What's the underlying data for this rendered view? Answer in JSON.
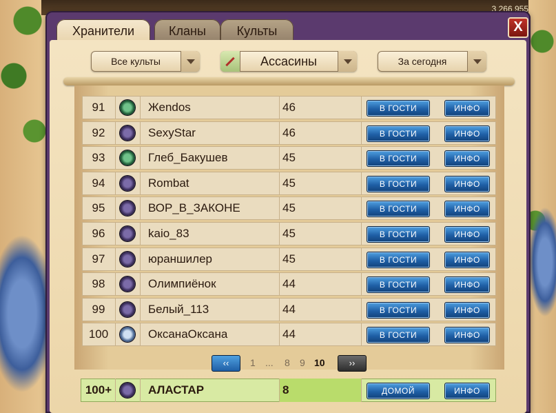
{
  "header": {
    "coins": "3 266 955"
  },
  "tabs": [
    {
      "label": "Хранители",
      "active": true
    },
    {
      "label": "Кланы",
      "active": false
    },
    {
      "label": "Культы",
      "active": false
    }
  ],
  "close_label": "X",
  "filters": {
    "cult": "Все культы",
    "class": "Ассасины",
    "period": "За сегодня"
  },
  "table": {
    "rows": [
      {
        "rank": "91",
        "name": "Жеndos",
        "score": "46",
        "emblem": "green",
        "visit": "В ГОСТИ",
        "info": "ИНФО"
      },
      {
        "rank": "92",
        "name": "SexyStar",
        "score": "46",
        "emblem": "purple",
        "visit": "В ГОСТИ",
        "info": "ИНФО"
      },
      {
        "rank": "93",
        "name": "Глеб_Бакушев",
        "score": "45",
        "emblem": "green",
        "visit": "В ГОСТИ",
        "info": "ИНФО"
      },
      {
        "rank": "94",
        "name": "Rombat",
        "score": "45",
        "emblem": "purple",
        "visit": "В ГОСТИ",
        "info": "ИНФО"
      },
      {
        "rank": "95",
        "name": "ВОР_В_ЗАКОНЕ",
        "score": "45",
        "emblem": "purple",
        "visit": "В ГОСТИ",
        "info": "ИНФО"
      },
      {
        "rank": "96",
        "name": "kaio_83",
        "score": "45",
        "emblem": "purple",
        "visit": "В ГОСТИ",
        "info": "ИНФО"
      },
      {
        "rank": "97",
        "name": "юраншилер",
        "score": "45",
        "emblem": "purple",
        "visit": "В ГОСТИ",
        "info": "ИНФО"
      },
      {
        "rank": "98",
        "name": "Олимпиёнок",
        "score": "44",
        "emblem": "purple",
        "visit": "В ГОСТИ",
        "info": "ИНФО"
      },
      {
        "rank": "99",
        "name": "Белый_113",
        "score": "44",
        "emblem": "purple",
        "visit": "В ГОСТИ",
        "info": "ИНФО"
      },
      {
        "rank": "100",
        "name": "ОксанаОксана",
        "score": "44",
        "emblem": "feather",
        "visit": "В ГОСТИ",
        "info": "ИНФО"
      }
    ]
  },
  "pager": {
    "prev": "‹‹",
    "next": "››",
    "pages": [
      "1",
      "...",
      "8",
      "9",
      "10"
    ],
    "current": "10"
  },
  "self": {
    "rank": "100+",
    "name": "АЛАСТАР",
    "score": "8",
    "home": "ДОМОЙ",
    "info": "ИНФО"
  },
  "colors": {
    "window": "#5b3a6e",
    "parchment": "#f4e4c2",
    "button_blue": "#1f5fa6",
    "self_row": "#d8eaa3"
  }
}
